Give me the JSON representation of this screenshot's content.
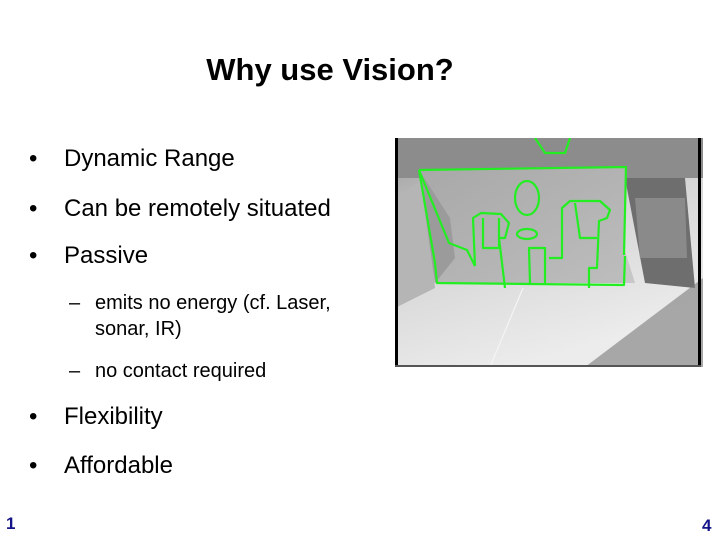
{
  "slide": {
    "title": "Why use Vision?",
    "bullets": [
      {
        "marker": "•",
        "text": "Dynamic Range"
      },
      {
        "marker": "•",
        "text": "Can be remotely situated"
      },
      {
        "marker": "•",
        "text": "Passive"
      }
    ],
    "sub_bullets": [
      {
        "marker": "–",
        "line1": "emits no energy (cf. Laser,",
        "line2": "sonar, IR)"
      },
      {
        "marker": "–",
        "line1": "no contact required"
      }
    ],
    "bullets_after": [
      {
        "marker": "•",
        "text": "Flexibility"
      },
      {
        "marker": "•",
        "text": "Affordable"
      }
    ],
    "image": {
      "description": "Grayscale camera image of a cardboard model with edges tracked in green overlay",
      "overlay_color": "#22ee22"
    },
    "footer": {
      "left_number": "1",
      "right_number": "4",
      "number_color": "#14148a"
    }
  }
}
